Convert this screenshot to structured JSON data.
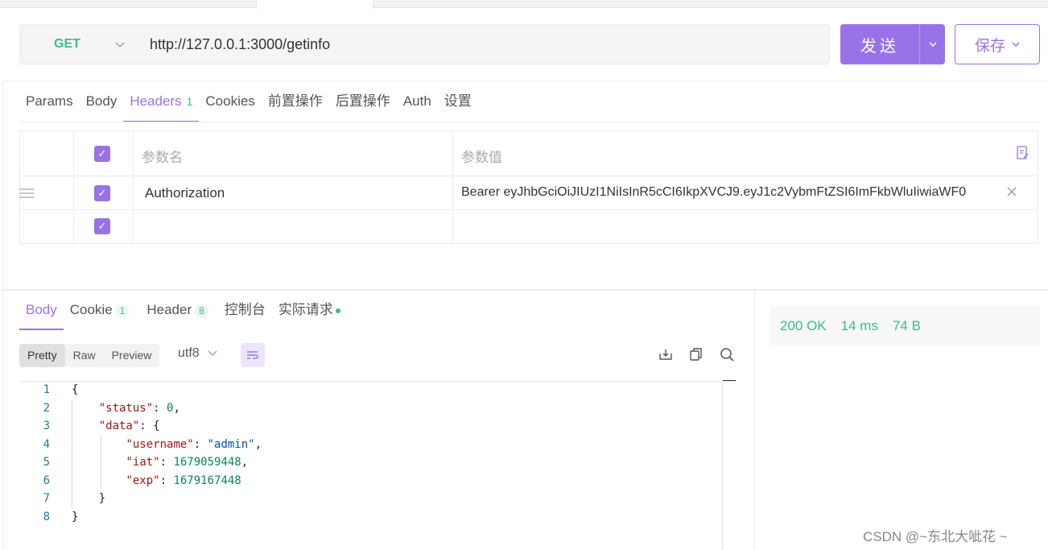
{
  "request": {
    "method": "GET",
    "url": "http://127.0.0.1:3000/getinfo",
    "send_label": "发送",
    "save_label": "保存"
  },
  "request_tabs": [
    {
      "label": "Params"
    },
    {
      "label": "Body"
    },
    {
      "label": "Headers",
      "count": "1",
      "active": true
    },
    {
      "label": "Cookies"
    },
    {
      "label": "前置操作"
    },
    {
      "label": "后置操作"
    },
    {
      "label": "Auth"
    },
    {
      "label": "设置"
    }
  ],
  "headers_table": {
    "col_name": "参数名",
    "col_value": "参数值",
    "rows": [
      {
        "checked": true,
        "name": "Authorization",
        "value": "Bearer eyJhbGciOiJIUzI1NiIsInR5cCI6IkpXVCJ9.eyJ1c2VybmFtZSI6ImFkbWluIiwiaWF0"
      },
      {
        "checked": true,
        "name": "",
        "value": ""
      }
    ]
  },
  "response_tabs": [
    {
      "label": "Body",
      "active": true
    },
    {
      "label": "Cookie",
      "count": "1"
    },
    {
      "label": "Header",
      "count": "8"
    },
    {
      "label": "控制台"
    },
    {
      "label": "实际请求",
      "dot": true
    }
  ],
  "format_tabs": [
    "Pretty",
    "Raw",
    "Preview"
  ],
  "active_format": "Pretty",
  "encoding": "utf8",
  "code_lines": [
    {
      "n": "1",
      "text": "{"
    },
    {
      "n": "2",
      "key": "\"status\"",
      "num": "0",
      "tail": ","
    },
    {
      "n": "3",
      "key": "\"data\"",
      "tail": ": {"
    },
    {
      "n": "4",
      "key": "\"username\"",
      "str": "\"admin\"",
      "tail": ","
    },
    {
      "n": "5",
      "key": "\"iat\"",
      "num": "1679059448",
      "tail": ","
    },
    {
      "n": "6",
      "key": "\"exp\"",
      "num": "1679167448"
    },
    {
      "n": "7",
      "text": "}"
    },
    {
      "n": "8",
      "text": "}"
    }
  ],
  "status": {
    "code": "200 OK",
    "time": "14 ms",
    "size": "74 B"
  },
  "watermark": "CSDN @~东北大呲花 ~",
  "colors": {
    "accent": "#9a72e8",
    "success": "#3dbb8c"
  }
}
